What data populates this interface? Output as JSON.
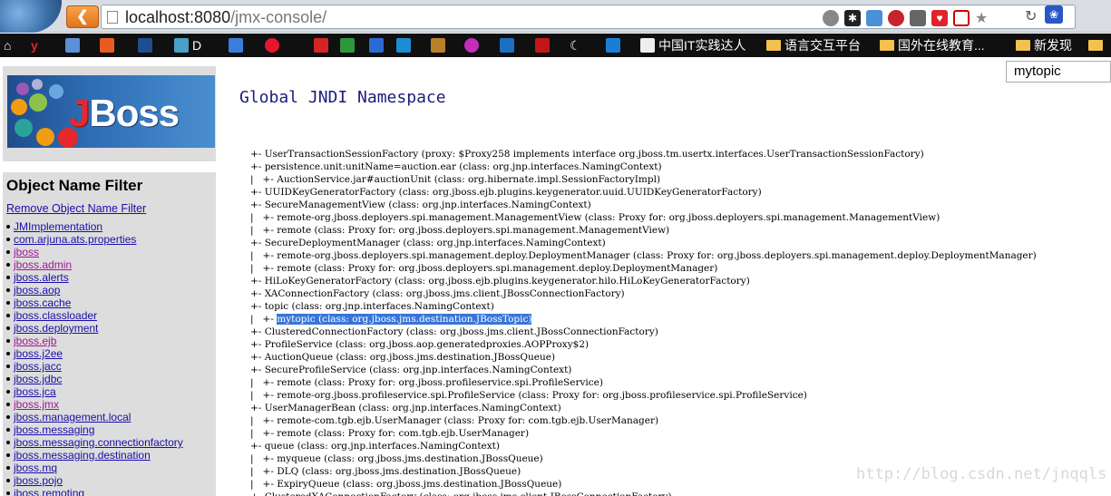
{
  "browser": {
    "url_host": "localhost:8080",
    "url_path": "/jmx-console/",
    "back_label": "❮"
  },
  "bookmarks": [
    {
      "label": "D"
    },
    {
      "label": "中国IT实践达人"
    },
    {
      "label": "语言交互平台"
    },
    {
      "label": "国外在线教育..."
    },
    {
      "label": "新发现"
    }
  ],
  "search": {
    "value": "mytopic"
  },
  "sidebar": {
    "filter_title": "Object Name Filter",
    "remove_filter": "Remove Object Name Filter",
    "domains": [
      {
        "label": "JMImplementation",
        "visited": false
      },
      {
        "label": "com.arjuna.ats.properties",
        "visited": false
      },
      {
        "label": "jboss",
        "visited": true
      },
      {
        "label": "jboss.admin",
        "visited": true
      },
      {
        "label": "jboss.alerts",
        "visited": false
      },
      {
        "label": "jboss.aop",
        "visited": false
      },
      {
        "label": "jboss.cache",
        "visited": false
      },
      {
        "label": "jboss.classloader",
        "visited": false
      },
      {
        "label": "jboss.deployment",
        "visited": false
      },
      {
        "label": "jboss.ejb",
        "visited": true
      },
      {
        "label": "jboss.j2ee",
        "visited": false
      },
      {
        "label": "jboss.jacc",
        "visited": false
      },
      {
        "label": "jboss.jdbc",
        "visited": false
      },
      {
        "label": "jboss.jca",
        "visited": false
      },
      {
        "label": "jboss.jmx",
        "visited": true
      },
      {
        "label": "jboss.management.local",
        "visited": false
      },
      {
        "label": "jboss.messaging",
        "visited": false
      },
      {
        "label": "jboss.messaging.connectionfactory",
        "visited": false
      },
      {
        "label": "jboss.messaging.destination",
        "visited": false
      },
      {
        "label": "jboss.mq",
        "visited": false
      },
      {
        "label": "jboss.pojo",
        "visited": false
      },
      {
        "label": "jboss.remoting",
        "visited": false
      }
    ]
  },
  "main": {
    "title": "Global JNDI Namespace",
    "tree": [
      {
        "prefix": "+- ",
        "text": "UserTransactionSessionFactory (proxy: $Proxy258 implements interface org.jboss.tm.usertx.interfaces.UserTransactionSessionFactory)"
      },
      {
        "prefix": "+- ",
        "text": "persistence.unit:unitName=auction.ear (class: org.jnp.interfaces.NamingContext)"
      },
      {
        "prefix": "|   +- ",
        "text": "AuctionService.jar#auctionUnit (class: org.hibernate.impl.SessionFactoryImpl)"
      },
      {
        "prefix": "+- ",
        "text": "UUIDKeyGeneratorFactory (class: org.jboss.ejb.plugins.keygenerator.uuid.UUIDKeyGeneratorFactory)"
      },
      {
        "prefix": "+- ",
        "text": "SecureManagementView (class: org.jnp.interfaces.NamingContext)"
      },
      {
        "prefix": "|   +- ",
        "text": "remote-org.jboss.deployers.spi.management.ManagementView (class: Proxy for: org.jboss.deployers.spi.management.ManagementView)"
      },
      {
        "prefix": "|   +- ",
        "text": "remote (class: Proxy for: org.jboss.deployers.spi.management.ManagementView)"
      },
      {
        "prefix": "+- ",
        "text": "SecureDeploymentManager (class: org.jnp.interfaces.NamingContext)"
      },
      {
        "prefix": "|   +- ",
        "text": "remote-org.jboss.deployers.spi.management.deploy.DeploymentManager (class: Proxy for: org.jboss.deployers.spi.management.deploy.DeploymentManager)"
      },
      {
        "prefix": "|   +- ",
        "text": "remote (class: Proxy for: org.jboss.deployers.spi.management.deploy.DeploymentManager)"
      },
      {
        "prefix": "+- ",
        "text": "HiLoKeyGeneratorFactory (class: org.jboss.ejb.plugins.keygenerator.hilo.HiLoKeyGeneratorFactory)"
      },
      {
        "prefix": "+- ",
        "text": "XAConnectionFactory (class: org.jboss.jms.client.JBossConnectionFactory)"
      },
      {
        "prefix": "+- ",
        "text": "topic (class: org.jnp.interfaces.NamingContext)"
      },
      {
        "prefix": "|   +- ",
        "text": "mytopic (class: org.jboss.jms.destination.JBossTopic)",
        "selected": true
      },
      {
        "prefix": "+- ",
        "text": "ClusteredConnectionFactory (class: org.jboss.jms.client.JBossConnectionFactory)"
      },
      {
        "prefix": "+- ",
        "text": "ProfileService (class: org.jboss.aop.generatedproxies.AOPProxy$2)"
      },
      {
        "prefix": "+- ",
        "text": "AuctionQueue (class: org.jboss.jms.destination.JBossQueue)"
      },
      {
        "prefix": "+- ",
        "text": "SecureProfileService (class: org.jnp.interfaces.NamingContext)"
      },
      {
        "prefix": "|   +- ",
        "text": "remote (class: Proxy for: org.jboss.profileservice.spi.ProfileService)"
      },
      {
        "prefix": "|   +- ",
        "text": "remote-org.jboss.profileservice.spi.ProfileService (class: Proxy for: org.jboss.profileservice.spi.ProfileService)"
      },
      {
        "prefix": "+- ",
        "text": "UserManagerBean (class: org.jnp.interfaces.NamingContext)"
      },
      {
        "prefix": "|   +- ",
        "text": "remote-com.tgb.ejb.UserManager (class: Proxy for: com.tgb.ejb.UserManager)"
      },
      {
        "prefix": "|   +- ",
        "text": "remote (class: Proxy for: com.tgb.ejb.UserManager)"
      },
      {
        "prefix": "+- ",
        "text": "queue (class: org.jnp.interfaces.NamingContext)"
      },
      {
        "prefix": "|   +- ",
        "text": "myqueue (class: org.jboss.jms.destination.JBossQueue)"
      },
      {
        "prefix": "|   +- ",
        "text": "DLQ (class: org.jboss.jms.destination.JBossQueue)"
      },
      {
        "prefix": "|   +- ",
        "text": "ExpiryQueue (class: org.jboss.jms.destination.JBossQueue)"
      },
      {
        "prefix": "+- ",
        "text": "ClusteredXAConnectionFactory (class: org.jboss.jms.client.JBossConnectionFactory)"
      }
    ]
  },
  "watermark": "http://blog.csdn.net/jnqqls"
}
